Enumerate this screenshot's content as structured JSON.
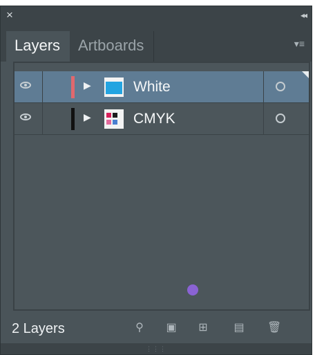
{
  "panel": {
    "close_glyph": "×",
    "collapse_glyph": "◂◂"
  },
  "tabs": [
    {
      "label": "Layers",
      "active": true
    },
    {
      "label": "Artboards",
      "active": false
    }
  ],
  "layers": [
    {
      "name": "White",
      "color": "#e0686e",
      "selected": true,
      "thumb": "blue"
    },
    {
      "name": "CMYK",
      "color": "#111111",
      "selected": false,
      "thumb": "cmyk"
    }
  ],
  "footer": {
    "count_label": "2 Layers"
  },
  "colors": {
    "panel_bg": "#4a5459",
    "selected_row": "#5f7c94",
    "accent_dot": "#8a63d4"
  }
}
